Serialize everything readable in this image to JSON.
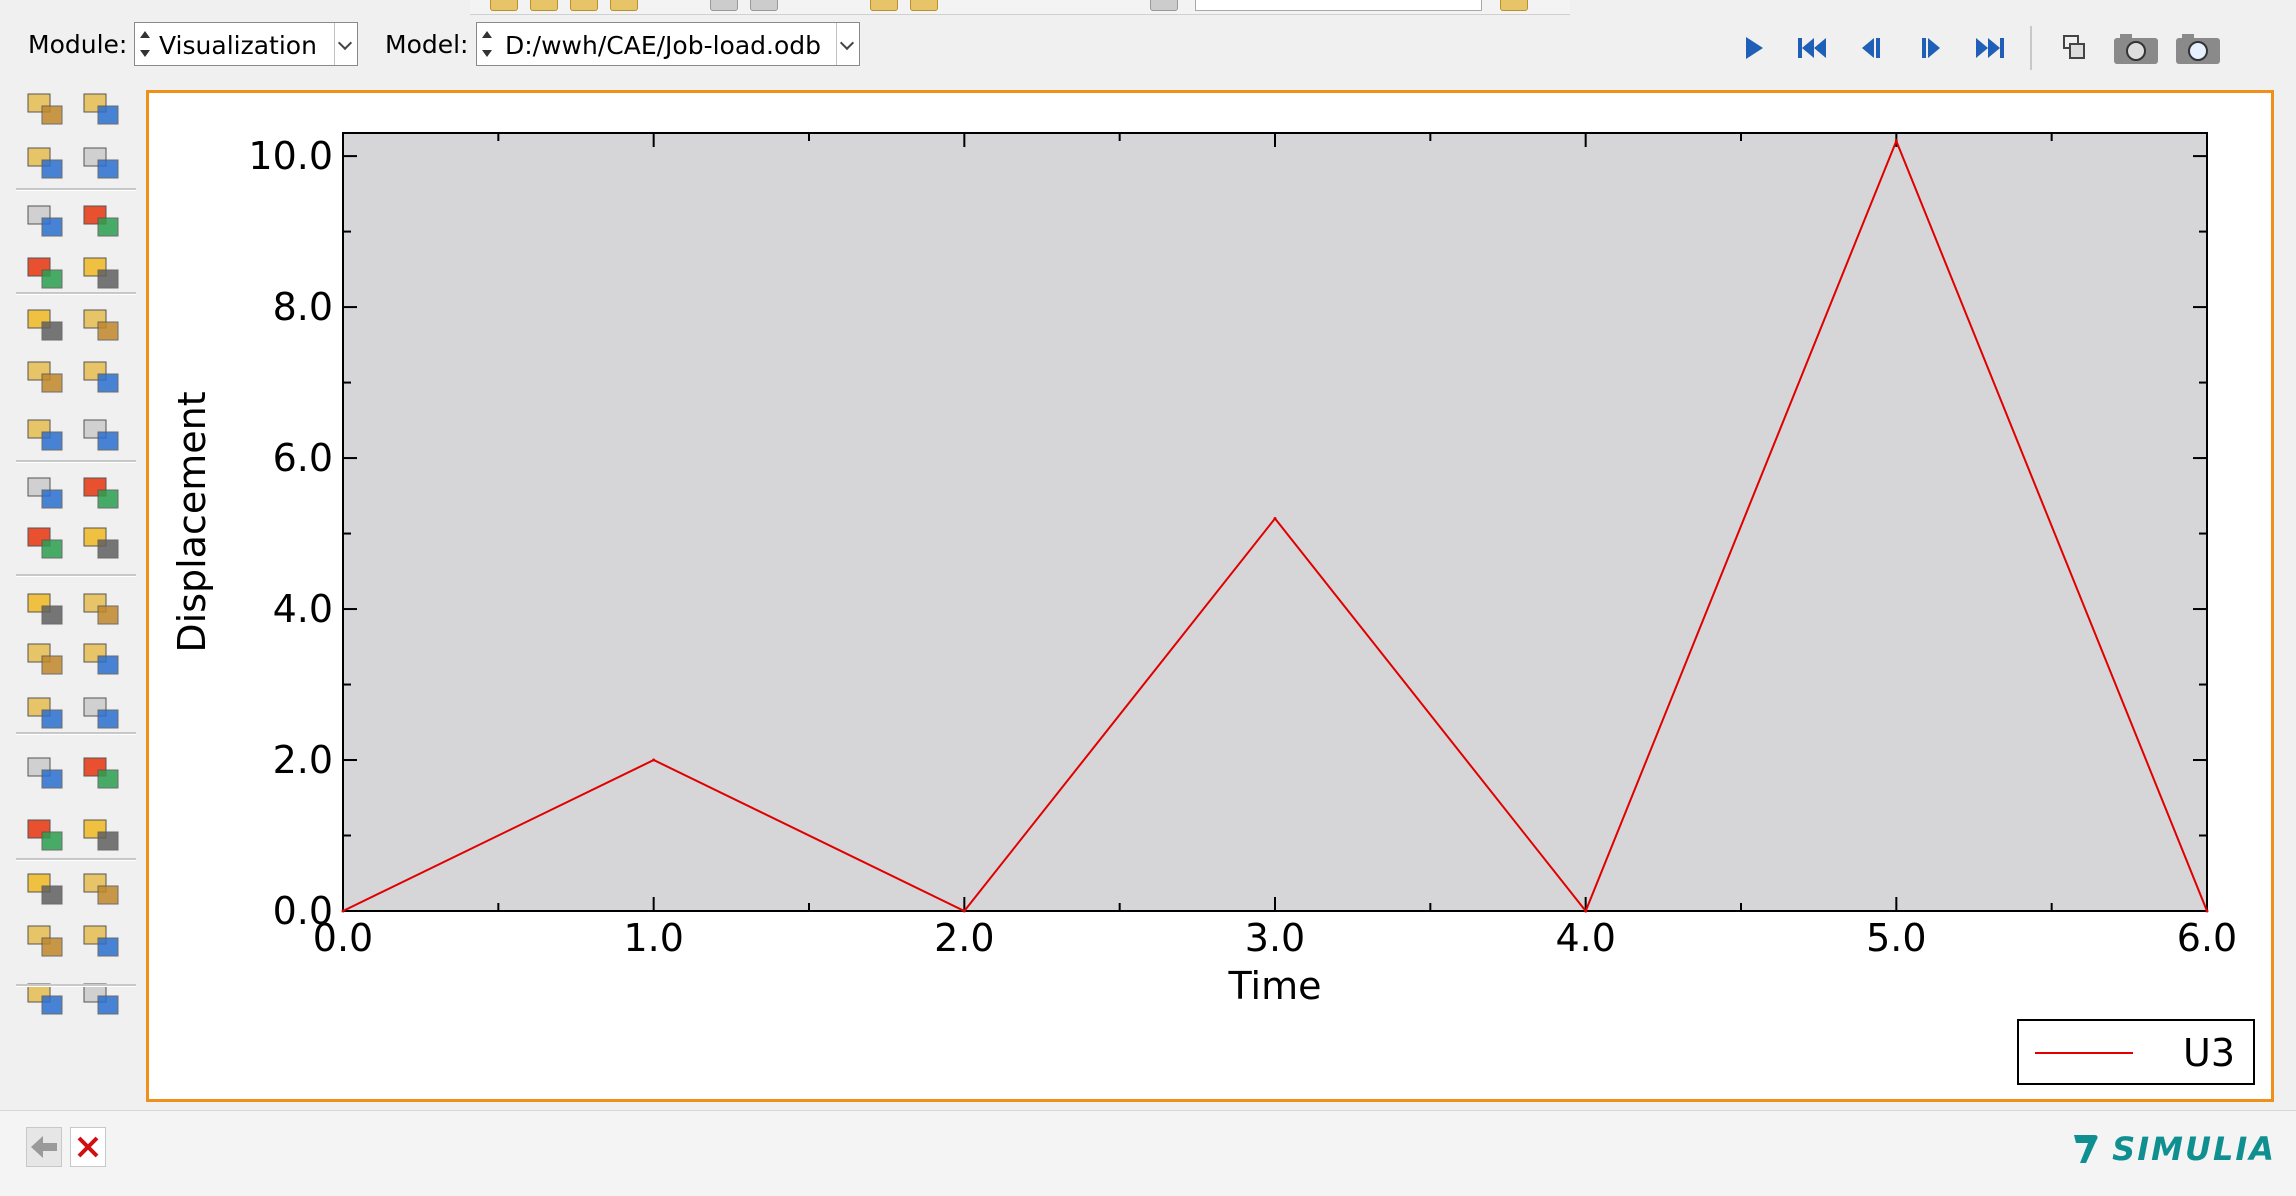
{
  "context_bar": {
    "module_label": "Module:",
    "module_value": "Visualization",
    "model_label": "Model:",
    "model_value": "D:/wwh/CAE/Job-load.odb"
  },
  "brand": {
    "name": "SIMULIA",
    "logo_mark": "3DS"
  },
  "icons": {
    "play": "play-icon",
    "first": "first-frame-icon",
    "prev": "previous-frame-icon",
    "next": "next-frame-icon",
    "last": "last-frame-icon",
    "options": "animation-options-icon",
    "capture1": "camera-icon",
    "capture2": "camera-icon",
    "back": "back-arrow-icon",
    "cancel": "close-icon"
  },
  "colors": {
    "viewport_border": "#f0901a",
    "plot_background": "#d6d5d8",
    "series_line": "#e00000",
    "brand": "#0f8f8f"
  },
  "chart_data": {
    "type": "line",
    "title": "",
    "xlabel": "Time",
    "ylabel": "Displacement",
    "xlim": [
      0,
      6
    ],
    "ylim": [
      0,
      10.2
    ],
    "xticks": [
      "0.0",
      "1.0",
      "2.0",
      "3.0",
      "4.0",
      "5.0",
      "6.0"
    ],
    "yticks": [
      "0.0",
      "2.0",
      "4.0",
      "6.0",
      "8.0",
      "10.0"
    ],
    "grid": false,
    "legend": "bottom-right",
    "series": [
      {
        "name": "U3",
        "x": [
          0,
          1,
          2,
          3,
          4,
          5,
          6
        ],
        "y": [
          0,
          2.0,
          0,
          5.2,
          0,
          10.2,
          0
        ]
      }
    ]
  }
}
